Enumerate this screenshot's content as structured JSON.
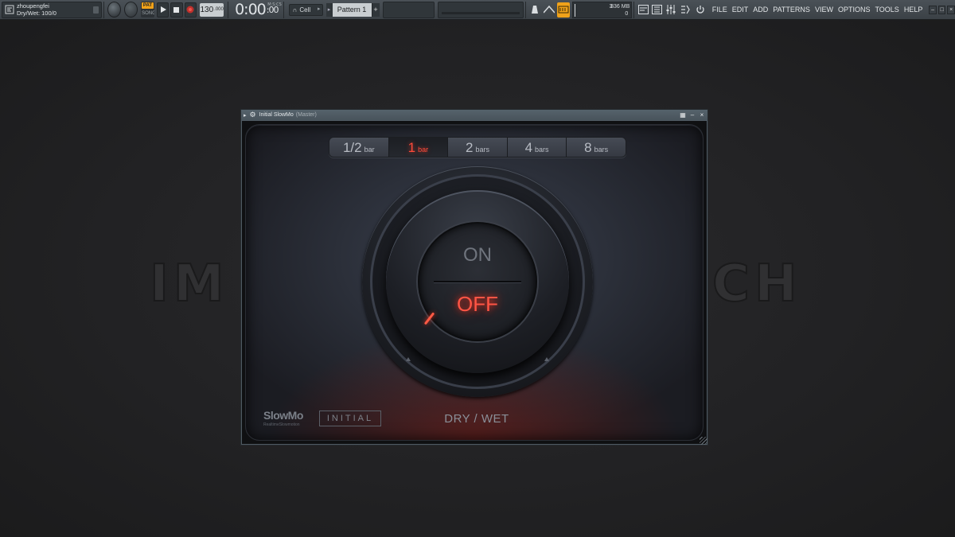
{
  "toolbar": {
    "hint_user": "zhoupengfei",
    "hint_value": "Dry/Wet: 100/0",
    "pat_label": "PAT",
    "song_label": "SONG",
    "tempo_value": "130",
    "tempo_decimal": ".000",
    "time_main": "0:00",
    "time_sub": ":00",
    "time_format_label": "M:S:CS",
    "snap_value": "Cell",
    "pattern_name": "Pattern 1",
    "pattern_add": "+",
    "cpu_count": "3",
    "memory": "336 MB",
    "polyphony": "0",
    "menu": [
      "FILE",
      "EDIT",
      "ADD",
      "PATTERNS",
      "VIEW",
      "OPTIONS",
      "TOOLS",
      "HELP"
    ]
  },
  "background": {
    "watermark_left": "IM",
    "watermark_right": "CH"
  },
  "plugin": {
    "title": "Initial SlowMo",
    "subtitle": "(Master)",
    "bar_options": [
      {
        "num": "1/2",
        "unit": "bar"
      },
      {
        "num": "1",
        "unit": "bar"
      },
      {
        "num": "2",
        "unit": "bars"
      },
      {
        "num": "4",
        "unit": "bars"
      },
      {
        "num": "8",
        "unit": "bars"
      }
    ],
    "selected_bar_index": 1,
    "knob_on_label": "ON",
    "knob_off_label": "OFF",
    "brand_name": "SlowMo",
    "brand_tagline": "RealtimeSlowmotion",
    "company_logo": "INITIAL",
    "drywet_label": "DRY / WET",
    "accent_color": "#ff4a3a"
  }
}
